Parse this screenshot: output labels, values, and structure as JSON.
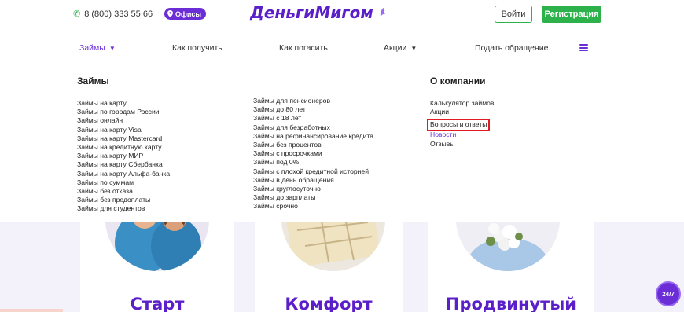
{
  "header": {
    "phone": "8 (800) 333 55 66",
    "offices_label": "Офисы",
    "logo_part1": "Деньги",
    "logo_part2": "Мигом",
    "login_label": "Войти",
    "register_label": "Регистрация"
  },
  "nav": {
    "items": [
      {
        "label": "Займы"
      },
      {
        "label": "Как получить"
      },
      {
        "label": "Как погасить"
      },
      {
        "label": "Акции"
      },
      {
        "label": "Подать обращение"
      }
    ]
  },
  "mega": {
    "col1_title": "Займы",
    "col1_links": [
      "Займы на карту",
      "Займы по городам России",
      "Займы онлайн",
      "Займы на карту Visa",
      "Займы на карту Mastercard",
      "Займы на кредитную карту",
      "Займы на карту МИР",
      "Займы на карту Сбербанка",
      "Займы на карту Альфа-банка",
      "Займы по суммам",
      "Займы без отказа",
      "Займы без предоплаты",
      "Займы для студентов"
    ],
    "col2_links": [
      "Займы для пенсионеров",
      "Займы до 80 лет",
      "Займы с 18 лет",
      "Займы для безработных",
      "Займы на рефинансирование кредита",
      "Займы без процентов",
      "Займы с просрочками",
      "Займы под 0%",
      "Займы с плохой кредитной историей",
      "Займы в день обращения",
      "Займы круглосуточно",
      "Займы до зарплаты",
      "Займы срочно"
    ],
    "col3_title": "О компании",
    "col3_links": [
      "Калькулятор займов",
      "Акции",
      "Вопросы и ответы",
      "Новости",
      "Отзывы"
    ]
  },
  "cards": [
    {
      "title": "Старт"
    },
    {
      "title": "Комфорт"
    },
    {
      "title": "Продвинутый"
    }
  ],
  "chat": {
    "label": "24/7"
  },
  "colors": {
    "brand_purple": "#6b2ed6",
    "brand_green": "#2db14a",
    "highlight_red": "#e01b24"
  }
}
